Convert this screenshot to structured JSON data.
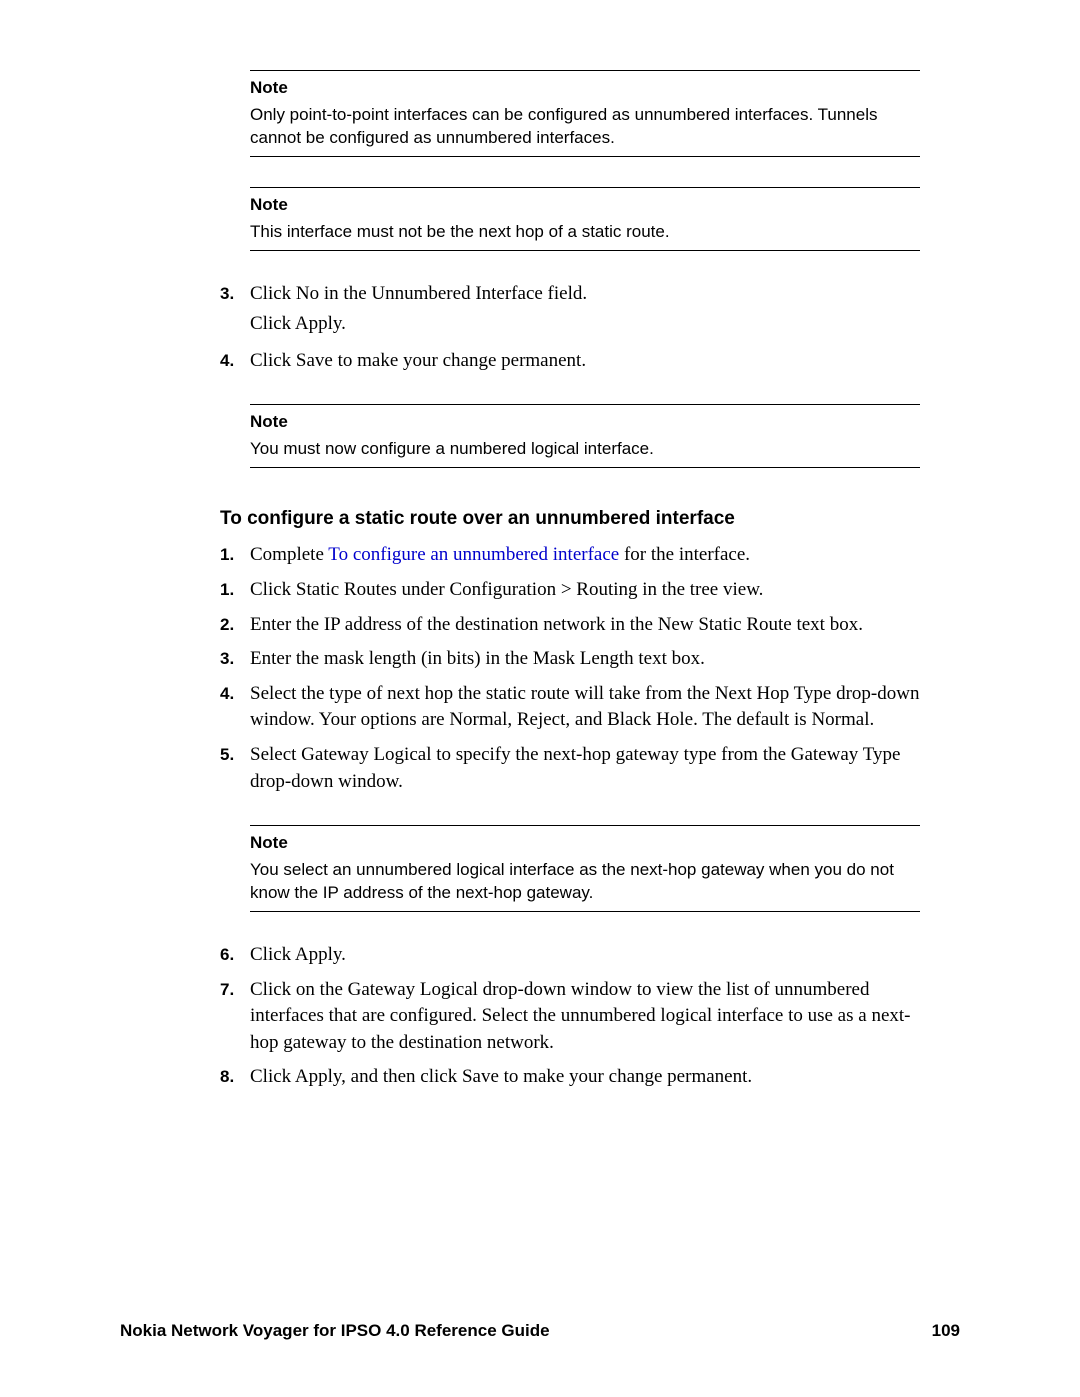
{
  "notes": [
    {
      "label": "Note",
      "text": "Only point-to-point interfaces can be configured as unnumbered interfaces. Tunnels cannot be configured as unnumbered interfaces."
    },
    {
      "label": "Note",
      "text": "This interface must not be the next hop of a static route."
    },
    {
      "label": "Note",
      "text": "You must now configure a numbered logical interface."
    },
    {
      "label": "Note",
      "text": "You select an unnumbered logical interface as the next-hop gateway when you do not know the IP address of the next-hop gateway."
    }
  ],
  "steps_top": {
    "s3": {
      "num": "3.",
      "line1": "Click No in the Unnumbered Interface field.",
      "line2": "Click Apply."
    },
    "s4": {
      "num": "4.",
      "line1": "Click Save to make your change permanent."
    }
  },
  "section2": {
    "title": "To configure a static route over an unnumbered interface",
    "s1a": {
      "num": "1.",
      "prefix": "Complete  ",
      "link": "To configure an unnumbered interface",
      "suffix": " for the interface."
    },
    "s1b": {
      "num": "1.",
      "text": "Click Static Routes under Configuration > Routing in the tree view."
    },
    "s2": {
      "num": "2.",
      "text": "Enter the IP address of the destination network in the New Static Route text box."
    },
    "s3": {
      "num": "3.",
      "text": "Enter the mask length (in bits) in the Mask Length text box."
    },
    "s4": {
      "num": "4.",
      "text": "Select the type of next hop the static route will take from the Next Hop Type drop-down window. Your options are Normal, Reject, and Black Hole. The default is Normal."
    },
    "s5": {
      "num": "5.",
      "text": "Select Gateway Logical to specify the next-hop gateway type from the Gateway Type drop-down window."
    },
    "s6": {
      "num": "6.",
      "text": "Click Apply."
    },
    "s7": {
      "num": "7.",
      "text": "Click on the Gateway Logical drop-down window to view the list of unnumbered interfaces that are configured. Select the unnumbered logical interface to use as a next-hop gateway to the destination network."
    },
    "s8": {
      "num": "8.",
      "text": "Click Apply, and then click Save to make your change permanent."
    }
  },
  "footer": {
    "title": "Nokia Network Voyager for IPSO 4.0 Reference Guide",
    "page": "109"
  }
}
